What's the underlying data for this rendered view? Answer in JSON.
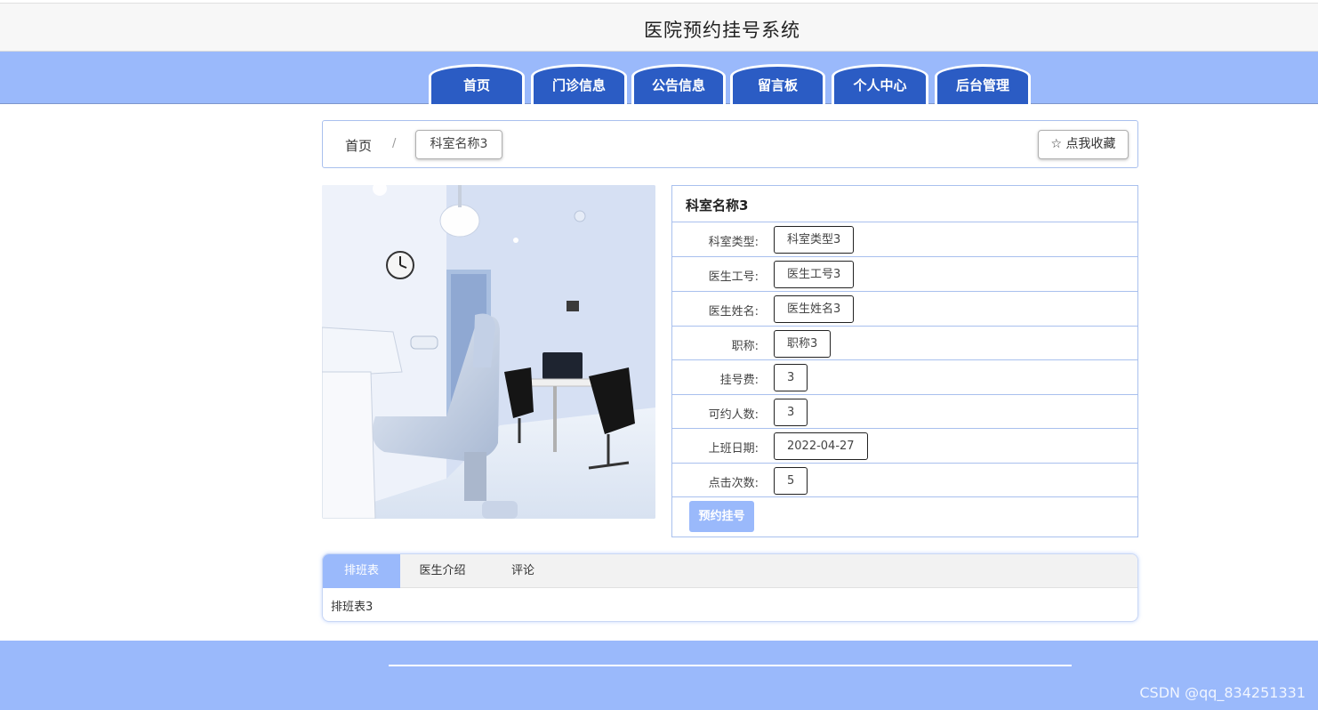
{
  "site": {
    "title": "医院预约挂号系统"
  },
  "nav": {
    "items": [
      {
        "label": "首页"
      },
      {
        "label": "门诊信息"
      },
      {
        "label": "公告信息"
      },
      {
        "label": "留言板"
      },
      {
        "label": "个人中心"
      },
      {
        "label": "后台管理"
      }
    ]
  },
  "breadcrumb": {
    "home": "首页",
    "separator": "/",
    "current": "科室名称3"
  },
  "favorite": {
    "label": "☆ 点我收藏"
  },
  "detail": {
    "title": "科室名称3",
    "fields": [
      {
        "label": "科室类型:",
        "value": "科室类型3"
      },
      {
        "label": "医生工号:",
        "value": "医生工号3"
      },
      {
        "label": "医生姓名:",
        "value": "医生姓名3"
      },
      {
        "label": "职称:",
        "value": "职称3"
      },
      {
        "label": "挂号费:",
        "value": "3"
      },
      {
        "label": "可约人数:",
        "value": "3"
      },
      {
        "label": "上班日期:",
        "value": "2022-04-27"
      },
      {
        "label": "点击次数:",
        "value": "5"
      }
    ],
    "book_button": "预约挂号"
  },
  "tabs": {
    "items": [
      {
        "label": "排班表",
        "active": true
      },
      {
        "label": "医生介绍",
        "active": false
      },
      {
        "label": "评论",
        "active": false
      }
    ],
    "content": "排班表3"
  },
  "footer": {
    "watermark": "CSDN @qq_834251331"
  },
  "colors": {
    "accent": "#9ab9fb",
    "nav_tab": "#2b5cc4",
    "border": "#a9c0ee"
  }
}
